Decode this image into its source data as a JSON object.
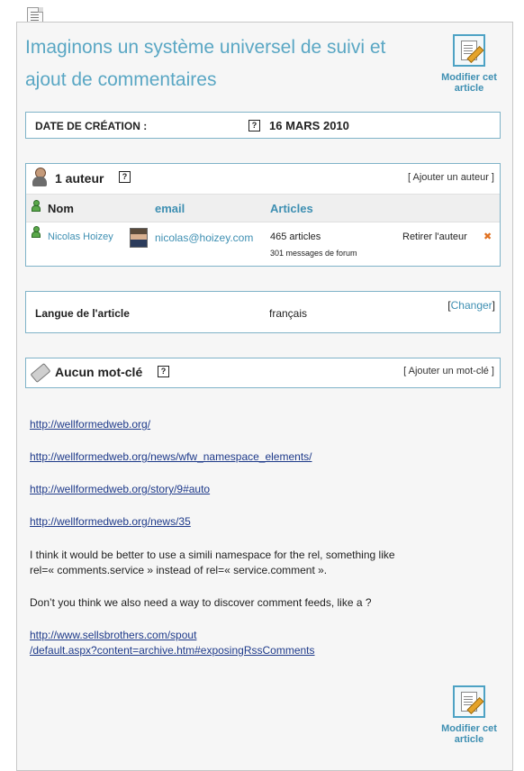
{
  "article": {
    "title": "Imaginons un système universel de suivi et ajout de commentaires",
    "edit_label_top": "Modifier cet article",
    "edit_label_bottom": "Modifier cet article"
  },
  "date_box": {
    "label": "DATE DE CRÉATION :",
    "help": "?",
    "value": "16 MARS 2010"
  },
  "authors": {
    "title": "1 auteur",
    "help": "?",
    "add_link": "[ Ajouter un auteur ]",
    "columns": {
      "nom": "Nom",
      "email": "email",
      "articles": "Articles"
    },
    "rows": [
      {
        "name": "Nicolas Hoizey",
        "email": "nicolas@hoizey.com",
        "articles": "465 articles",
        "messages": "301 messages de forum",
        "remove": "Retirer l'auteur",
        "remove_icon": "✖"
      }
    ]
  },
  "language": {
    "label": "Langue de l'article",
    "value": "français",
    "change_open": "[",
    "change_link": "Changer",
    "change_close": "]"
  },
  "keywords": {
    "title": "Aucun mot-clé",
    "help": "?",
    "add_link": "[ Ajouter un mot-clé ]"
  },
  "content": {
    "link1": "http://wellformedweb.org/",
    "link2": "http://wellformedweb.org/news/wfw_namespace_elements/",
    "link3": "http://wellformedweb.org/story/9#auto",
    "link4": "http://wellformedweb.org/news/35",
    "para1_line1": "I think it would be better to use a simili namespace for the rel, something like",
    "para1_line2": "rel=« comments.service » instead of rel=« service.comment ».",
    "para2": "Don’t you think we also need a way to discover comment feeds, like a  ?",
    "link5_line1": "http://www.sellsbrothers.com/spout",
    "link5_line2": "/default.aspx?content=archive.htm#exposingRssComments"
  },
  "colors": {
    "accent": "#5aa7c4",
    "link": "#3e8fb2",
    "border": "#7fb3c8"
  },
  "icons": [
    "page-icon",
    "edit-article-icon",
    "author-icon",
    "person-icon",
    "keyword-tag-icon",
    "remove-icon",
    "help-icon"
  ]
}
